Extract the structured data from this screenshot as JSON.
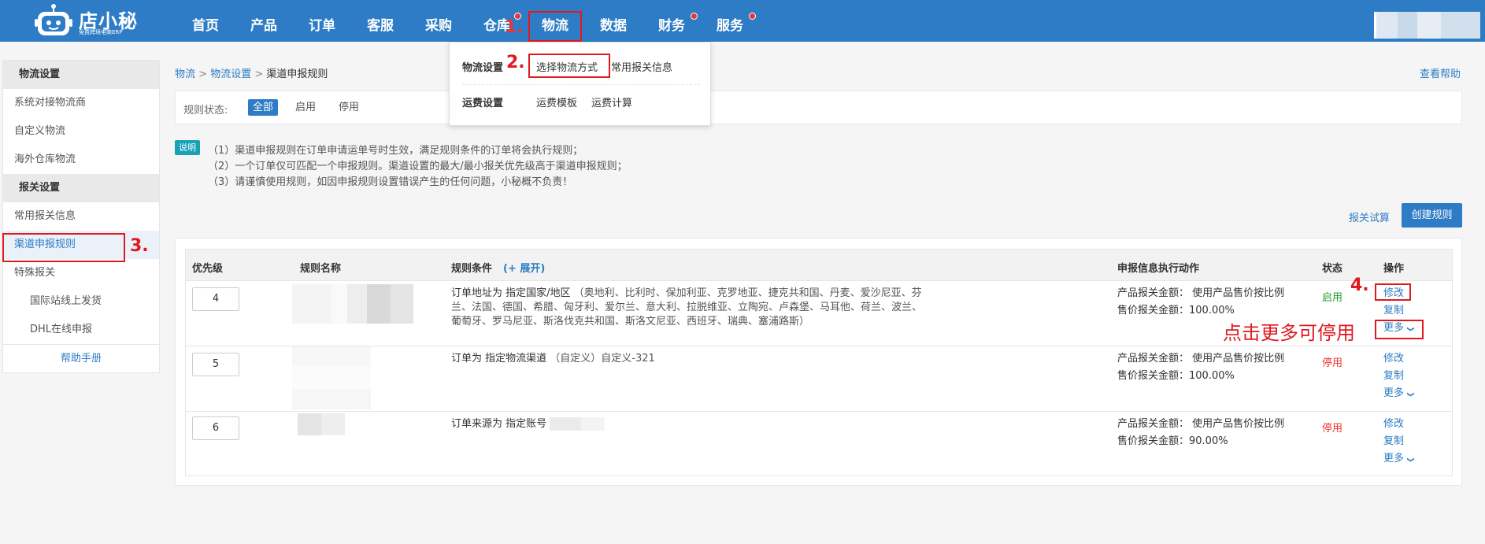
{
  "logo": {
    "name": "店小秘",
    "subtitle": "免费跨境电商ERP"
  },
  "nav": [
    "首页",
    "产品",
    "订单",
    "客服",
    "采购",
    "仓库",
    "物流",
    "数据",
    "财务",
    "服务"
  ],
  "annotations": {
    "step1": "1.",
    "step2": "2.",
    "step3": "3.",
    "step4": "4.",
    "hint": "点击更多可停用"
  },
  "dropdown": {
    "logistics_settings": "物流设置",
    "select_method": "选择物流方式",
    "customs_info": "常用报关信息",
    "freight_settings": "运费设置",
    "freight_template": "运费模板",
    "freight_calc": "运费计算"
  },
  "sidebar": {
    "group1": "物流设置",
    "items1": [
      "系统对接物流商",
      "自定义物流",
      "海外仓库物流"
    ],
    "group2": "报关设置",
    "items2": [
      "常用报关信息",
      "渠道申报规则",
      "特殊报关"
    ],
    "sub_items": [
      "国际站线上发货",
      "DHL在线申报"
    ],
    "help": "帮助手册"
  },
  "breadcrumb": {
    "a": "物流",
    "sep": ">",
    "b": "物流设置",
    "c": "渠道申报规则"
  },
  "help_link": "查看帮助",
  "filter": {
    "label": "规则状态:",
    "options": [
      "全部",
      "启用",
      "停用"
    ]
  },
  "notes": {
    "badge": "说明",
    "lines": [
      "（1）渠道申报规则在订单申请运单号时生效，满足规则条件的订单将会执行规则；",
      "（2）一个订单仅可匹配一个申报规则。渠道设置的最大/最小报关优先级高于渠道申报规则；",
      "（3）请谨慎使用规则，如因申报规则设置错误产生的任何问题，小秘概不负责！"
    ]
  },
  "actions": {
    "trial": "报关试算",
    "create": "创建规则"
  },
  "table": {
    "headers": {
      "priority": "优先级",
      "name": "规则名称",
      "condition": "规则条件",
      "expand": "(+ 展开)",
      "action": "申报信息执行动作",
      "status": "状态",
      "op": "操作"
    },
    "rows": [
      {
        "priority": "4",
        "cond_prefix": "订单地址为 指定国家/地区",
        "cond_detail": "（奥地利、比利时、保加利亚、克罗地亚、捷克共和国、丹麦、爱沙尼亚、芬兰、法国、德国、希腊、匈牙利、爱尔兰、意大利、拉脱维亚、立陶宛、卢森堡、马耳他、荷兰、波兰、葡萄牙、罗马尼亚、斯洛伐克共和国、斯洛文尼亚、西班牙、瑞典、塞浦路斯）",
        "action1": "产品报关金额：  使用产品售价按比例",
        "action2": "售价报关金额：100.00%",
        "status": "启用",
        "ops": [
          "修改",
          "复制",
          "更多"
        ]
      },
      {
        "priority": "5",
        "cond_prefix": "订单为 指定物流渠道",
        "cond_detail": "（自定义）自定义-321",
        "action1": "产品报关金额：  使用产品售价按比例",
        "action2": "售价报关金额：100.00%",
        "status": "停用",
        "ops": [
          "修改",
          "复制",
          "更多"
        ]
      },
      {
        "priority": "6",
        "cond_prefix": "订单来源为 指定账号",
        "cond_detail": "",
        "action1": "产品报关金额：  使用产品售价按比例",
        "action2": "售价报关金额：90.00%",
        "status": "停用",
        "ops": [
          "修改",
          "复制",
          "更多"
        ]
      }
    ]
  },
  "colors": {
    "brand": "#2d7cc5",
    "annotation": "#e0191f",
    "enabled": "#1e9e2b",
    "disabled": "#e33333"
  }
}
